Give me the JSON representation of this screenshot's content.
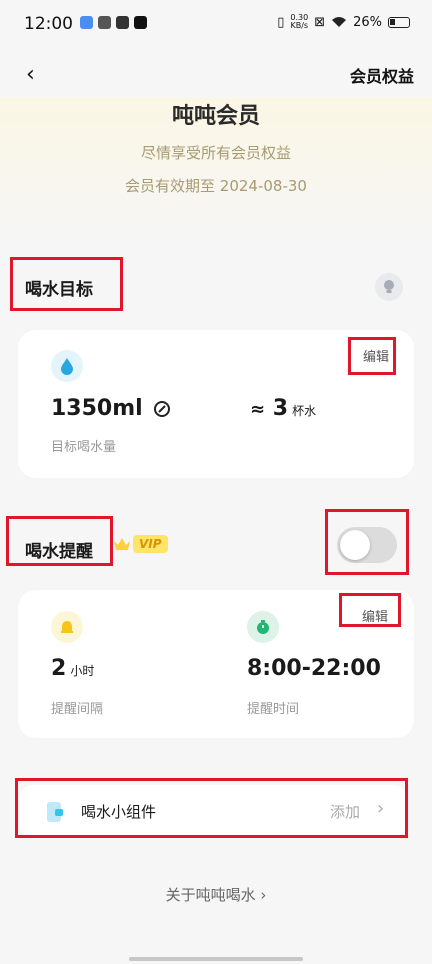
{
  "status_bar": {
    "time": "12:00",
    "net_speed_value": "0.30",
    "net_speed_unit": "KB/s",
    "battery": "26%"
  },
  "header": {
    "back_glyph": "‹",
    "benefits_label": "会员权益"
  },
  "hero": {
    "title": "吨吨会员",
    "subtitle": "尽情享受所有会员权益",
    "expiry": "会员有效期至 2024-08-30"
  },
  "goal": {
    "title": "喝水目标",
    "edit_label": "编辑",
    "amount": "1350ml",
    "cups_prefix": "≈",
    "cups_value": "3",
    "cups_unit": "杯水",
    "caption": "目标喝水量"
  },
  "reminder": {
    "title": "喝水提醒",
    "vip_label": "VIP",
    "enabled": false,
    "edit_label": "编辑",
    "interval_value": "2",
    "interval_unit": "小时",
    "interval_caption": "提醒间隔",
    "time_range": "8:00-22:00",
    "time_caption": "提醒时间"
  },
  "widget": {
    "label": "喝水小组件",
    "action": "添加"
  },
  "footer": {
    "about_label": "关于吨吨喝水 ›"
  },
  "colors": {
    "accent_gold": "#a89a73",
    "highlight_red": "#e0162b",
    "drop_blue": "#29a8e0",
    "bell_yellow": "#f5c518",
    "timer_green": "#22b573"
  }
}
